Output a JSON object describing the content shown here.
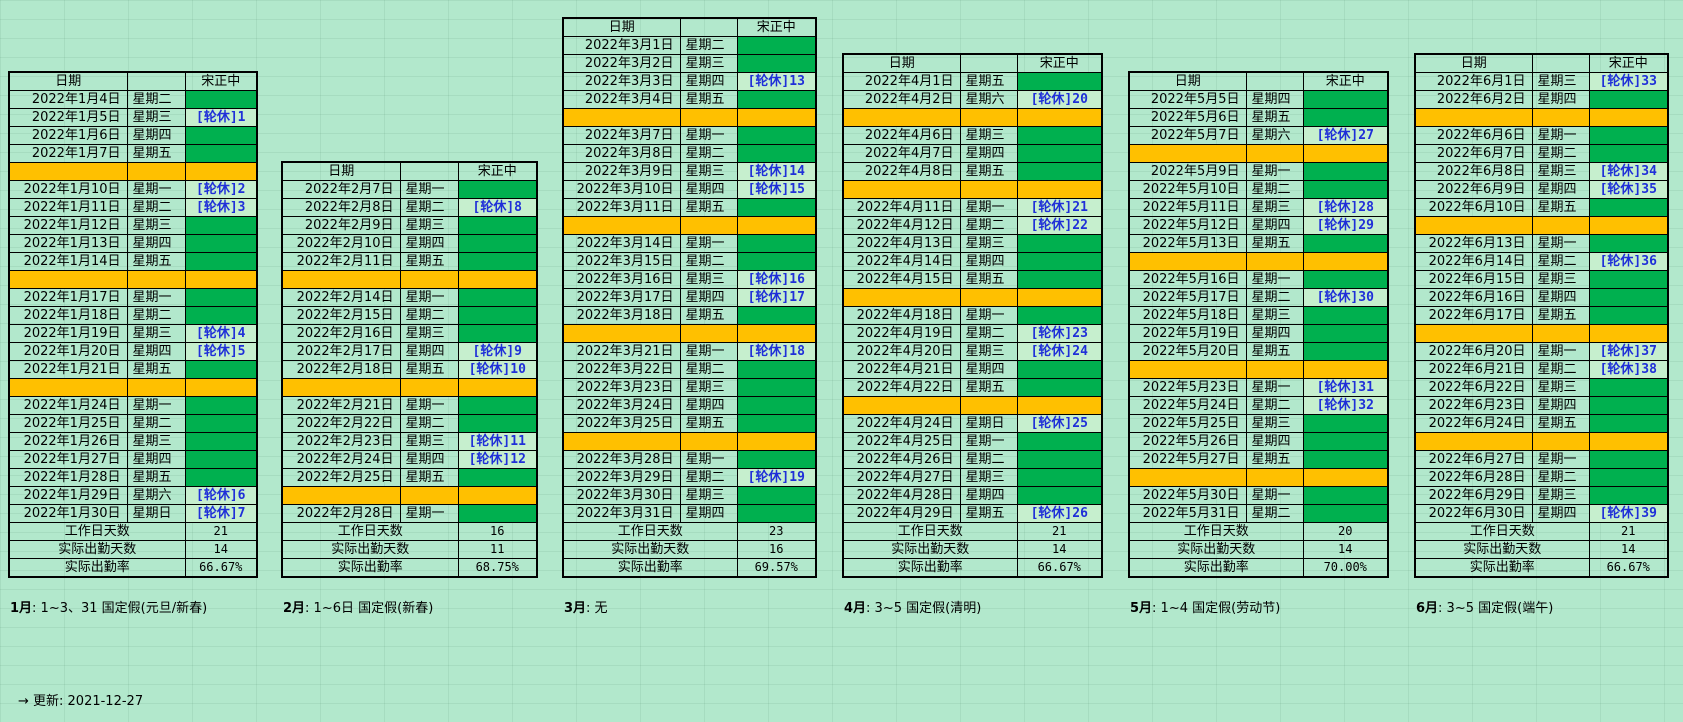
{
  "col_headers": {
    "date": "日期",
    "name": "宋正中"
  },
  "sum_labels": {
    "workdays": "工作日天数",
    "attended": "实际出勤天数",
    "rate": "实际出勤率"
  },
  "months": [
    {
      "rows": [
        {
          "d": "2022年1月4日",
          "w": "星期二",
          "s": ""
        },
        {
          "d": "2022年1月5日",
          "w": "星期三",
          "s": "[轮休]1"
        },
        {
          "d": "2022年1月6日",
          "w": "星期四",
          "s": ""
        },
        {
          "d": "2022年1月7日",
          "w": "星期五",
          "s": ""
        },
        {
          "sep": true
        },
        {
          "d": "2022年1月10日",
          "w": "星期一",
          "s": "[轮休]2"
        },
        {
          "d": "2022年1月11日",
          "w": "星期二",
          "s": "[轮休]3"
        },
        {
          "d": "2022年1月12日",
          "w": "星期三",
          "s": ""
        },
        {
          "d": "2022年1月13日",
          "w": "星期四",
          "s": ""
        },
        {
          "d": "2022年1月14日",
          "w": "星期五",
          "s": ""
        },
        {
          "sep": true
        },
        {
          "d": "2022年1月17日",
          "w": "星期一",
          "s": ""
        },
        {
          "d": "2022年1月18日",
          "w": "星期二",
          "s": ""
        },
        {
          "d": "2022年1月19日",
          "w": "星期三",
          "s": "[轮休]4"
        },
        {
          "d": "2022年1月20日",
          "w": "星期四",
          "s": "[轮休]5"
        },
        {
          "d": "2022年1月21日",
          "w": "星期五",
          "s": ""
        },
        {
          "sep": true
        },
        {
          "d": "2022年1月24日",
          "w": "星期一",
          "s": ""
        },
        {
          "d": "2022年1月25日",
          "w": "星期二",
          "s": ""
        },
        {
          "d": "2022年1月26日",
          "w": "星期三",
          "s": ""
        },
        {
          "d": "2022年1月27日",
          "w": "星期四",
          "s": ""
        },
        {
          "d": "2022年1月28日",
          "w": "星期五",
          "s": ""
        },
        {
          "d": "2022年1月29日",
          "w": "星期六",
          "s": "[轮休]6"
        },
        {
          "d": "2022年1月30日",
          "w": "星期日",
          "s": "[轮休]7"
        }
      ],
      "workdays": "21",
      "attended": "14",
      "rate": "66.67%",
      "note_label": "1月",
      "note_text": ": 1~3、31 国定假(元旦/新春)"
    },
    {
      "rows": [
        {
          "d": "2022年2月7日",
          "w": "星期一",
          "s": ""
        },
        {
          "d": "2022年2月8日",
          "w": "星期二",
          "s": "[轮休]8"
        },
        {
          "d": "2022年2月9日",
          "w": "星期三",
          "s": ""
        },
        {
          "d": "2022年2月10日",
          "w": "星期四",
          "s": ""
        },
        {
          "d": "2022年2月11日",
          "w": "星期五",
          "s": ""
        },
        {
          "sep": true
        },
        {
          "d": "2022年2月14日",
          "w": "星期一",
          "s": ""
        },
        {
          "d": "2022年2月15日",
          "w": "星期二",
          "s": ""
        },
        {
          "d": "2022年2月16日",
          "w": "星期三",
          "s": ""
        },
        {
          "d": "2022年2月17日",
          "w": "星期四",
          "s": "[轮休]9"
        },
        {
          "d": "2022年2月18日",
          "w": "星期五",
          "s": "[轮休]10"
        },
        {
          "sep": true
        },
        {
          "d": "2022年2月21日",
          "w": "星期一",
          "s": ""
        },
        {
          "d": "2022年2月22日",
          "w": "星期二",
          "s": ""
        },
        {
          "d": "2022年2月23日",
          "w": "星期三",
          "s": "[轮休]11"
        },
        {
          "d": "2022年2月24日",
          "w": "星期四",
          "s": "[轮休]12"
        },
        {
          "d": "2022年2月25日",
          "w": "星期五",
          "s": ""
        },
        {
          "sep": true
        },
        {
          "d": "2022年2月28日",
          "w": "星期一",
          "s": ""
        }
      ],
      "workdays": "16",
      "attended": "11",
      "rate": "68.75%",
      "note_label": "2月",
      "note_text": ": 1~6日 国定假(新春)"
    },
    {
      "rows": [
        {
          "d": "2022年3月1日",
          "w": "星期二",
          "s": ""
        },
        {
          "d": "2022年3月2日",
          "w": "星期三",
          "s": ""
        },
        {
          "d": "2022年3月3日",
          "w": "星期四",
          "s": "[轮休]13"
        },
        {
          "d": "2022年3月4日",
          "w": "星期五",
          "s": ""
        },
        {
          "sep": true
        },
        {
          "d": "2022年3月7日",
          "w": "星期一",
          "s": ""
        },
        {
          "d": "2022年3月8日",
          "w": "星期二",
          "s": ""
        },
        {
          "d": "2022年3月9日",
          "w": "星期三",
          "s": "[轮休]14"
        },
        {
          "d": "2022年3月10日",
          "w": "星期四",
          "s": "[轮休]15"
        },
        {
          "d": "2022年3月11日",
          "w": "星期五",
          "s": ""
        },
        {
          "sep": true
        },
        {
          "d": "2022年3月14日",
          "w": "星期一",
          "s": ""
        },
        {
          "d": "2022年3月15日",
          "w": "星期二",
          "s": ""
        },
        {
          "d": "2022年3月16日",
          "w": "星期三",
          "s": "[轮休]16"
        },
        {
          "d": "2022年3月17日",
          "w": "星期四",
          "s": "[轮休]17"
        },
        {
          "d": "2022年3月18日",
          "w": "星期五",
          "s": ""
        },
        {
          "sep": true
        },
        {
          "d": "2022年3月21日",
          "w": "星期一",
          "s": "[轮休]18"
        },
        {
          "d": "2022年3月22日",
          "w": "星期二",
          "s": ""
        },
        {
          "d": "2022年3月23日",
          "w": "星期三",
          "s": ""
        },
        {
          "d": "2022年3月24日",
          "w": "星期四",
          "s": ""
        },
        {
          "d": "2022年3月25日",
          "w": "星期五",
          "s": ""
        },
        {
          "sep": true
        },
        {
          "d": "2022年3月28日",
          "w": "星期一",
          "s": ""
        },
        {
          "d": "2022年3月29日",
          "w": "星期二",
          "s": "[轮休]19"
        },
        {
          "d": "2022年3月30日",
          "w": "星期三",
          "s": ""
        },
        {
          "d": "2022年3月31日",
          "w": "星期四",
          "s": ""
        }
      ],
      "workdays": "23",
      "attended": "16",
      "rate": "69.57%",
      "note_label": "3月",
      "note_text": ": 无"
    },
    {
      "rows": [
        {
          "d": "2022年4月1日",
          "w": "星期五",
          "s": ""
        },
        {
          "d": "2022年4月2日",
          "w": "星期六",
          "s": "[轮休]20"
        },
        {
          "sep": true
        },
        {
          "d": "2022年4月6日",
          "w": "星期三",
          "s": ""
        },
        {
          "d": "2022年4月7日",
          "w": "星期四",
          "s": ""
        },
        {
          "d": "2022年4月8日",
          "w": "星期五",
          "s": ""
        },
        {
          "sep": true
        },
        {
          "d": "2022年4月11日",
          "w": "星期一",
          "s": "[轮休]21"
        },
        {
          "d": "2022年4月12日",
          "w": "星期二",
          "s": "[轮休]22"
        },
        {
          "d": "2022年4月13日",
          "w": "星期三",
          "s": ""
        },
        {
          "d": "2022年4月14日",
          "w": "星期四",
          "s": ""
        },
        {
          "d": "2022年4月15日",
          "w": "星期五",
          "s": ""
        },
        {
          "sep": true
        },
        {
          "d": "2022年4月18日",
          "w": "星期一",
          "s": ""
        },
        {
          "d": "2022年4月19日",
          "w": "星期二",
          "s": "[轮休]23"
        },
        {
          "d": "2022年4月20日",
          "w": "星期三",
          "s": "[轮休]24"
        },
        {
          "d": "2022年4月21日",
          "w": "星期四",
          "s": ""
        },
        {
          "d": "2022年4月22日",
          "w": "星期五",
          "s": ""
        },
        {
          "sep": true
        },
        {
          "d": "2022年4月24日",
          "w": "星期日",
          "s": "[轮休]25"
        },
        {
          "d": "2022年4月25日",
          "w": "星期一",
          "s": ""
        },
        {
          "d": "2022年4月26日",
          "w": "星期二",
          "s": ""
        },
        {
          "d": "2022年4月27日",
          "w": "星期三",
          "s": ""
        },
        {
          "d": "2022年4月28日",
          "w": "星期四",
          "s": ""
        },
        {
          "d": "2022年4月29日",
          "w": "星期五",
          "s": "[轮休]26"
        }
      ],
      "workdays": "21",
      "attended": "14",
      "rate": "66.67%",
      "note_label": "4月",
      "note_text": ": 3~5 国定假(清明)"
    },
    {
      "rows": [
        {
          "d": "2022年5月5日",
          "w": "星期四",
          "s": ""
        },
        {
          "d": "2022年5月6日",
          "w": "星期五",
          "s": ""
        },
        {
          "d": "2022年5月7日",
          "w": "星期六",
          "s": "[轮休]27"
        },
        {
          "sep": true
        },
        {
          "d": "2022年5月9日",
          "w": "星期一",
          "s": ""
        },
        {
          "d": "2022年5月10日",
          "w": "星期二",
          "s": ""
        },
        {
          "d": "2022年5月11日",
          "w": "星期三",
          "s": "[轮休]28"
        },
        {
          "d": "2022年5月12日",
          "w": "星期四",
          "s": "[轮休]29"
        },
        {
          "d": "2022年5月13日",
          "w": "星期五",
          "s": ""
        },
        {
          "sep": true
        },
        {
          "d": "2022年5月16日",
          "w": "星期一",
          "s": ""
        },
        {
          "d": "2022年5月17日",
          "w": "星期二",
          "s": "[轮休]30"
        },
        {
          "d": "2022年5月18日",
          "w": "星期三",
          "s": ""
        },
        {
          "d": "2022年5月19日",
          "w": "星期四",
          "s": ""
        },
        {
          "d": "2022年5月20日",
          "w": "星期五",
          "s": ""
        },
        {
          "sep": true
        },
        {
          "d": "2022年5月23日",
          "w": "星期一",
          "s": "[轮休]31"
        },
        {
          "d": "2022年5月24日",
          "w": "星期二",
          "s": "[轮休]32"
        },
        {
          "d": "2022年5月25日",
          "w": "星期三",
          "s": ""
        },
        {
          "d": "2022年5月26日",
          "w": "星期四",
          "s": ""
        },
        {
          "d": "2022年5月27日",
          "w": "星期五",
          "s": ""
        },
        {
          "sep": true
        },
        {
          "d": "2022年5月30日",
          "w": "星期一",
          "s": ""
        },
        {
          "d": "2022年5月31日",
          "w": "星期二",
          "s": ""
        }
      ],
      "workdays": "20",
      "attended": "14",
      "rate": "70.00%",
      "note_label": "5月",
      "note_text": ": 1~4 国定假(劳动节)"
    },
    {
      "rows": [
        {
          "d": "2022年6月1日",
          "w": "星期三",
          "s": "[轮休]33"
        },
        {
          "d": "2022年6月2日",
          "w": "星期四",
          "s": ""
        },
        {
          "sep": true
        },
        {
          "d": "2022年6月6日",
          "w": "星期一",
          "s": ""
        },
        {
          "d": "2022年6月7日",
          "w": "星期二",
          "s": ""
        },
        {
          "d": "2022年6月8日",
          "w": "星期三",
          "s": "[轮休]34"
        },
        {
          "d": "2022年6月9日",
          "w": "星期四",
          "s": "[轮休]35"
        },
        {
          "d": "2022年6月10日",
          "w": "星期五",
          "s": ""
        },
        {
          "sep": true
        },
        {
          "d": "2022年6月13日",
          "w": "星期一",
          "s": ""
        },
        {
          "d": "2022年6月14日",
          "w": "星期二",
          "s": "[轮休]36"
        },
        {
          "d": "2022年6月15日",
          "w": "星期三",
          "s": ""
        },
        {
          "d": "2022年6月16日",
          "w": "星期四",
          "s": ""
        },
        {
          "d": "2022年6月17日",
          "w": "星期五",
          "s": ""
        },
        {
          "sep": true
        },
        {
          "d": "2022年6月20日",
          "w": "星期一",
          "s": "[轮休]37"
        },
        {
          "d": "2022年6月21日",
          "w": "星期二",
          "s": "[轮休]38"
        },
        {
          "d": "2022年6月22日",
          "w": "星期三",
          "s": ""
        },
        {
          "d": "2022年6月23日",
          "w": "星期四",
          "s": ""
        },
        {
          "d": "2022年6月24日",
          "w": "星期五",
          "s": ""
        },
        {
          "sep": true
        },
        {
          "d": "2022年6月27日",
          "w": "星期一",
          "s": ""
        },
        {
          "d": "2022年6月28日",
          "w": "星期二",
          "s": ""
        },
        {
          "d": "2022年6月29日",
          "w": "星期三",
          "s": ""
        },
        {
          "d": "2022年6月30日",
          "w": "星期四",
          "s": "[轮休]39"
        }
      ],
      "workdays": "21",
      "attended": "14",
      "rate": "66.67%",
      "note_label": "6月",
      "note_text": ": 3~5 国定假(端午)"
    }
  ],
  "update_text": "→ 更新: 2021-12-27"
}
